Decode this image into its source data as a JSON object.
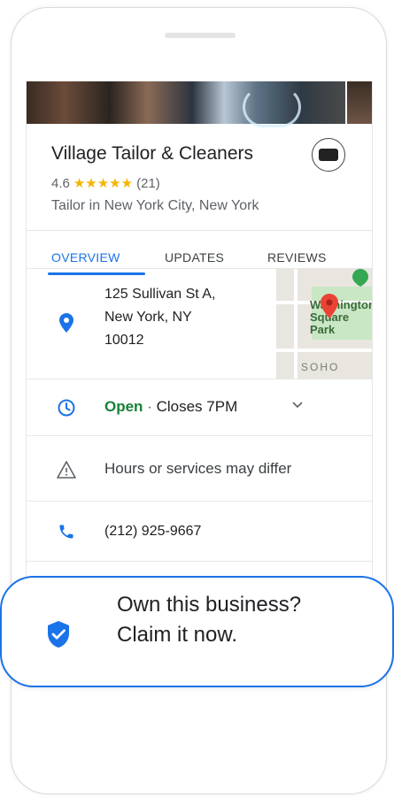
{
  "business": {
    "name": "Village Tailor & Cleaners",
    "rating": "4.6",
    "stars": "★★★★★",
    "review_count": "(21)",
    "category": "Tailor in New York City, New York"
  },
  "tabs": [
    {
      "label": "OVERVIEW",
      "active": true
    },
    {
      "label": "UPDATES",
      "active": false
    },
    {
      "label": "REVIEWS",
      "active": false
    }
  ],
  "address": {
    "line1": "125 Sullivan St A,",
    "line2": "New York, NY",
    "line3": "10012"
  },
  "map": {
    "label_line1": "Washington",
    "label_line2": "Square Park",
    "neighborhood": "SOHO"
  },
  "hours": {
    "status": "Open",
    "separator": "·",
    "closes": "Closes 7PM"
  },
  "alert": {
    "text": "Hours or services may differ"
  },
  "phone": {
    "number": "(212) 925-9667"
  },
  "callout": {
    "line1": "Own this business?",
    "line2": "Claim it now."
  },
  "colors": {
    "accent": "#1a73e8",
    "open_green": "#188038",
    "star": "#f5b400",
    "pin_red": "#ea4335"
  },
  "icons": [
    "location-pin-icon",
    "clock-icon",
    "warning-icon",
    "phone-icon",
    "verified-shield-icon",
    "chevron-down-icon",
    "map-pin-icon"
  ]
}
